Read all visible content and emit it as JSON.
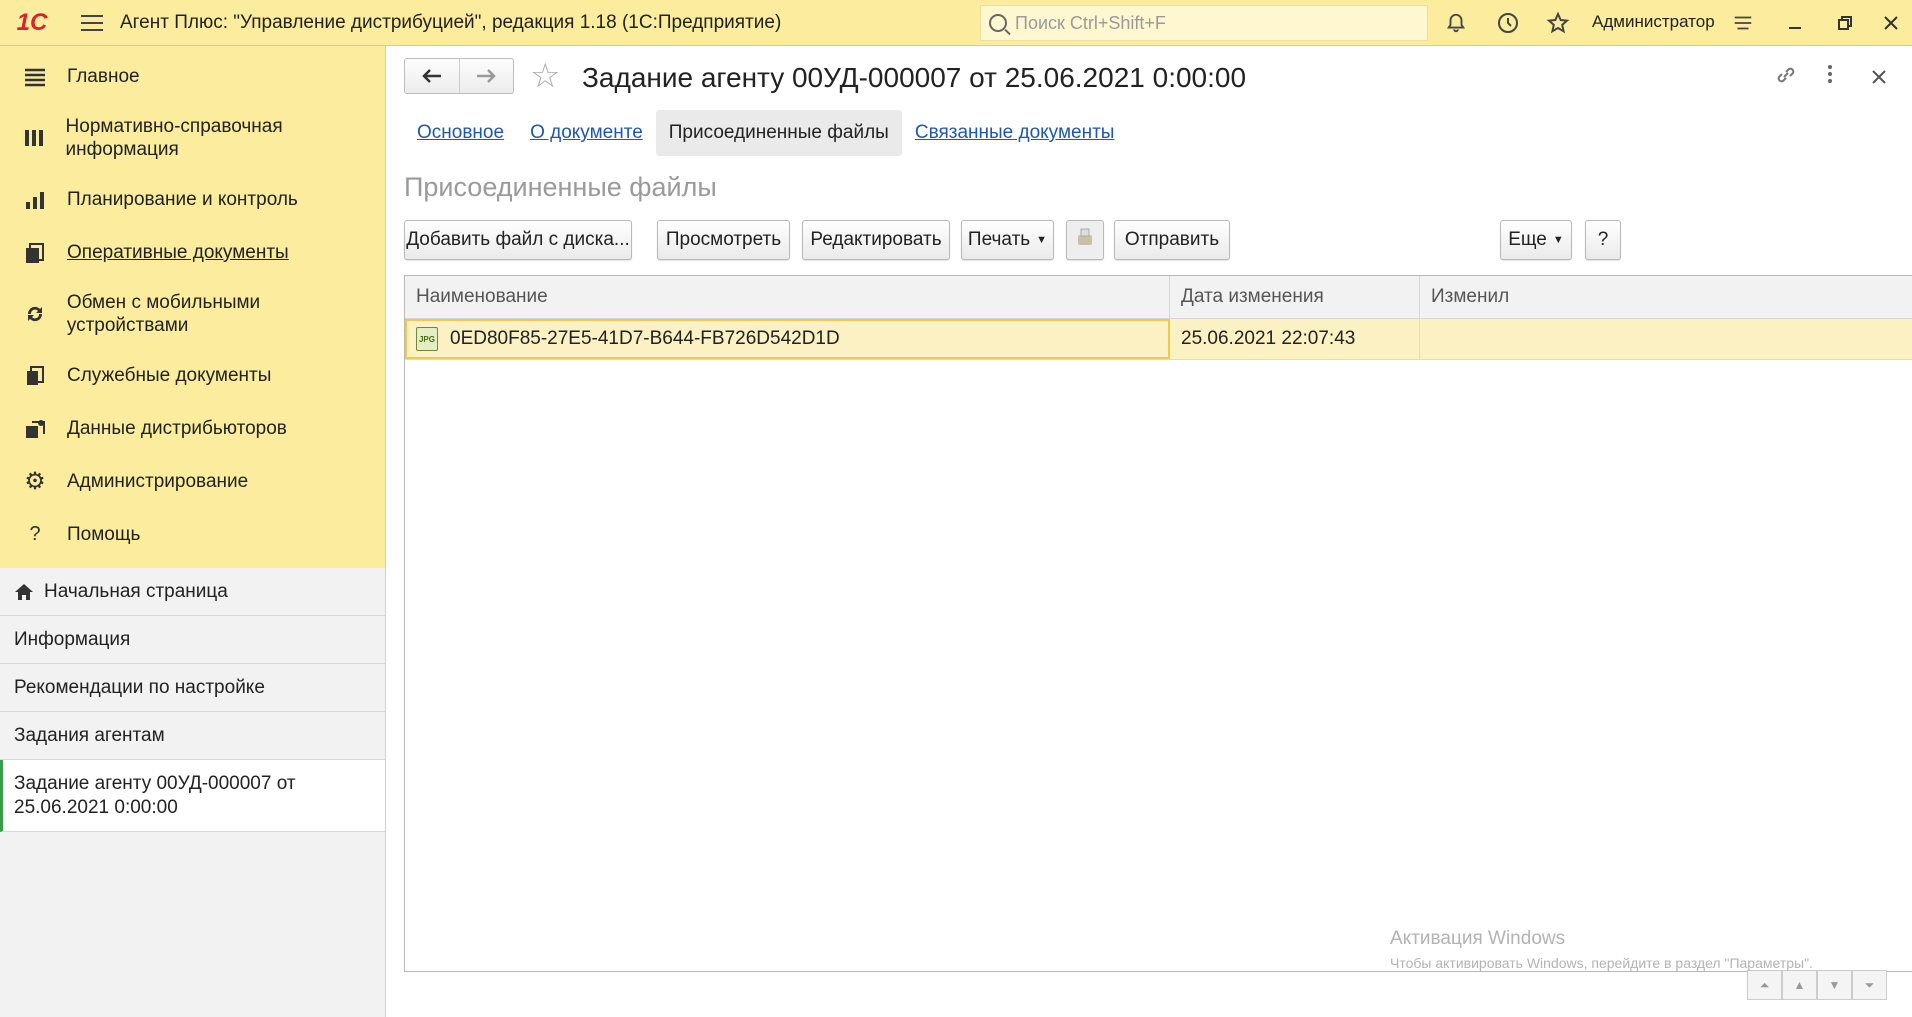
{
  "titlebar": {
    "logo": "1С",
    "title": "Агент Плюс: \"Управление дистрибуцией\", редакция 1.18  (1С:Предприятие)",
    "search_placeholder": "Поиск Ctrl+Shift+F",
    "user": "Администратор"
  },
  "sidebar": {
    "sections": [
      {
        "label": "Главное",
        "icon": "list-icon"
      },
      {
        "label": "Нормативно-справочная информация",
        "icon": "catalog-icon"
      },
      {
        "label": "Планирование и контроль",
        "icon": "chart-icon"
      },
      {
        "label": "Оперативные документы",
        "icon": "documents-icon"
      },
      {
        "label": "Обмен с мобильными устройствами",
        "icon": "sync-icon"
      },
      {
        "label": "Служебные документы",
        "icon": "service-docs-icon"
      },
      {
        "label": "Данные дистрибьюторов",
        "icon": "distributors-icon"
      },
      {
        "label": "Администрирование",
        "icon": "gear-icon"
      },
      {
        "label": "Помощь",
        "icon": "help-icon"
      }
    ],
    "open_items": [
      {
        "label": "Начальная страница"
      },
      {
        "label": "Информация"
      },
      {
        "label": "Рекомендации по настройке"
      },
      {
        "label": "Задания агентам"
      },
      {
        "label": "Задание агенту 00УД-000007 от 25.06.2021 0:00:00"
      }
    ]
  },
  "document": {
    "title": "Задание агенту 00УД-000007 от 25.06.2021 0:00:00",
    "tabs": [
      "Основное",
      "О документе",
      "Присоединенные файлы",
      "Связанные документы"
    ],
    "section_title": "Присоединенные файлы"
  },
  "commands": {
    "add_file": "Добавить файл с диска...",
    "view": "Просмотреть",
    "edit": "Редактировать",
    "print": "Печать",
    "send": "Отправить",
    "more": "Еще",
    "help": "?"
  },
  "table": {
    "columns": [
      "Наименование",
      "Дата изменения",
      "Изменил"
    ],
    "rows": [
      {
        "name": "0ED80F85-27E5-41D7-B644-FB726D542D1D",
        "file_type": "JPG",
        "modified": "25.06.2021 22:07:43",
        "author": ""
      }
    ]
  },
  "watermark": {
    "line1": "Активация Windows",
    "line2": "Чтобы активировать Windows, перейдите в раздел \"Параметры\"."
  },
  "colors": {
    "accent": "#fbec9e",
    "link": "#1d59a8",
    "selected_row": "#fbf1c2",
    "current_marker": "#3a9b4a"
  }
}
